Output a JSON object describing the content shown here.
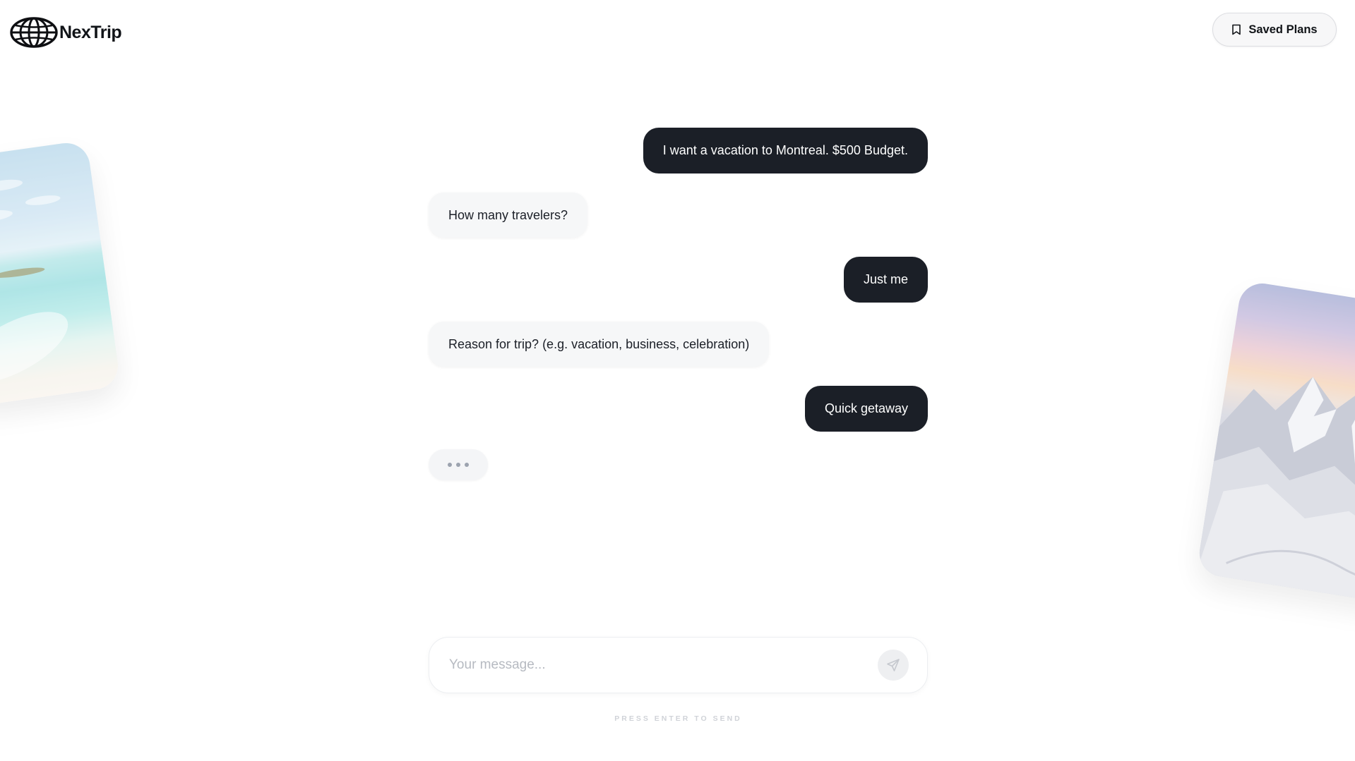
{
  "app": {
    "name": "NexTrip",
    "logo_icon": "globe-icon"
  },
  "header": {
    "saved_plans_label": "Saved Plans",
    "saved_plans_icon": "bookmark-icon"
  },
  "chat": {
    "messages": [
      {
        "role": "user",
        "text": "I want a vacation to Montreal. $500 Budget."
      },
      {
        "role": "assistant",
        "text": "How many travelers?"
      },
      {
        "role": "user",
        "text": "Just me"
      },
      {
        "role": "assistant",
        "text": "Reason for trip? (e.g. vacation, business, celebration)"
      },
      {
        "role": "user",
        "text": "Quick getaway"
      }
    ],
    "typing_indicator": true
  },
  "composer": {
    "placeholder": "Your message...",
    "value": "",
    "send_icon": "send-icon",
    "hint": "PRESS ENTER TO SEND"
  },
  "decor": {
    "left_card": "beach-photo",
    "right_card": "mountain-photo"
  },
  "colors": {
    "user_bubble": "#1b1f27",
    "assistant_bubble": "#f6f7f8",
    "text": "#1b1f27"
  }
}
